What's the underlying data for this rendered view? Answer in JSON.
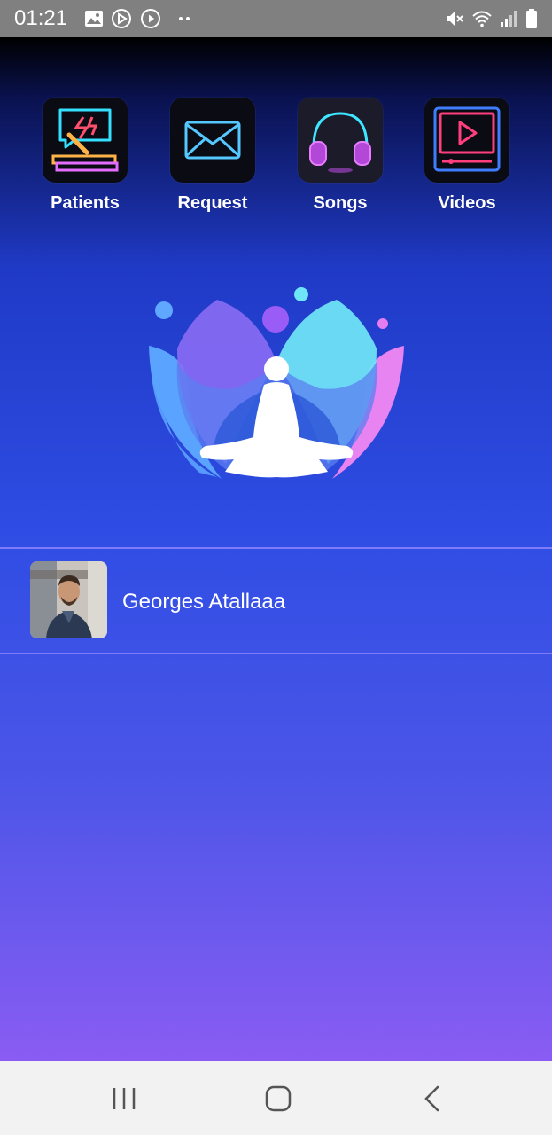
{
  "status_bar": {
    "time": "01:21",
    "icons": [
      "image-icon",
      "play-store-icon",
      "play-circle-icon",
      "more-dots-icon",
      "mute-icon",
      "wifi-icon",
      "signal-icon",
      "battery-icon"
    ]
  },
  "menu": {
    "items": [
      {
        "label": "Patients",
        "icon": "patients-icon"
      },
      {
        "label": "Request",
        "icon": "envelope-icon"
      },
      {
        "label": "Songs",
        "icon": "headphones-icon"
      },
      {
        "label": "Videos",
        "icon": "video-player-icon"
      }
    ]
  },
  "logo": {
    "icon": "meditation-lotus-icon"
  },
  "patients": [
    {
      "name": "Georges Atallaaa"
    }
  ],
  "nav_bar": {
    "icons": [
      "recent-apps-icon",
      "home-icon",
      "back-icon"
    ]
  },
  "colors": {
    "status_bar": "#808080",
    "gradient_top": "#000000",
    "gradient_mid": "#2f4de4",
    "gradient_bottom": "#8a5cf3",
    "nav_bar": "#f2f2f2",
    "divider": "#7f7af7"
  }
}
